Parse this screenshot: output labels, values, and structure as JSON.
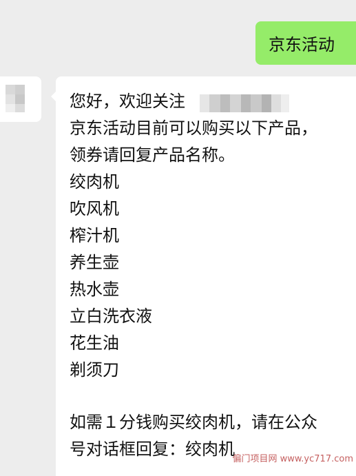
{
  "outgoing_message": {
    "text": "京东活动"
  },
  "incoming_message": {
    "greeting": "您好，欢迎关注",
    "intro_line1": "京东活动目前可以购买以下产品，",
    "intro_line2": "领券请回复产品名称。",
    "products": [
      "绞肉机",
      "吹风机",
      "榨汁机",
      "养生壶",
      "热水壶",
      "立白洗衣液",
      "花生油",
      "剃须刀"
    ],
    "offer_line1": "如需１分钱购买绞肉机，请在公众",
    "offer_line2": "号对话框回复：绞肉机"
  },
  "watermark": {
    "text": "偏门项目网 www.yc717.com"
  },
  "colors": {
    "background": "#ededed",
    "outgoing_bubble": "#95ec69",
    "incoming_bubble": "#ffffff",
    "text": "#111111"
  }
}
